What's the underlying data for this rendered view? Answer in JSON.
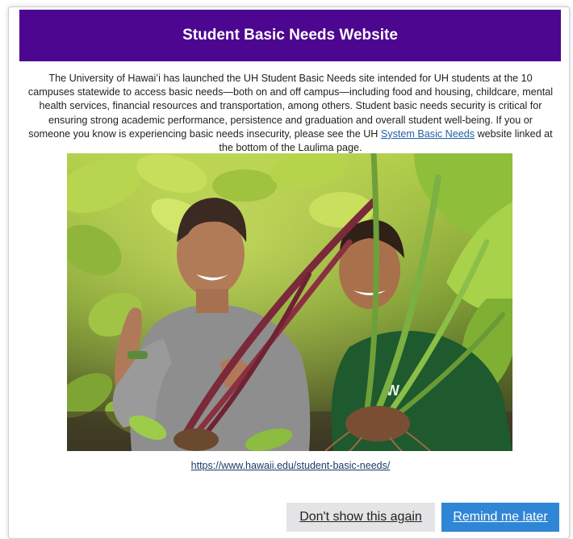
{
  "modal": {
    "title": "Student Basic Needs Website",
    "paragraph_before_link": "The University of Hawaiʻi has launched the UH Student Basic Needs site intended for UH students at the 10 campuses statewide to access basic needs—both on and off campus—including food and housing, childcare, mental health services, financial resources and transportation, among others. Student basic needs security is critical for ensuring strong academic performance, persistence and graduation and overall student well-being. If you or someone you know is experiencing basic needs insecurity, please see the UH ",
    "inline_link_text": "System Basic Needs",
    "paragraph_after_link": " website linked at the bottom of the Laulima page.",
    "site_url": "https://www.hawaii.edu/student-basic-needs/",
    "buttons": {
      "dont_show": "Don't show this again",
      "remind_later": "Remind me later"
    }
  },
  "colors": {
    "header_bg": "#4d068f",
    "primary_button": "#2f86d6",
    "secondary_button": "#e4e4e6",
    "link": "#1f5fa8"
  }
}
